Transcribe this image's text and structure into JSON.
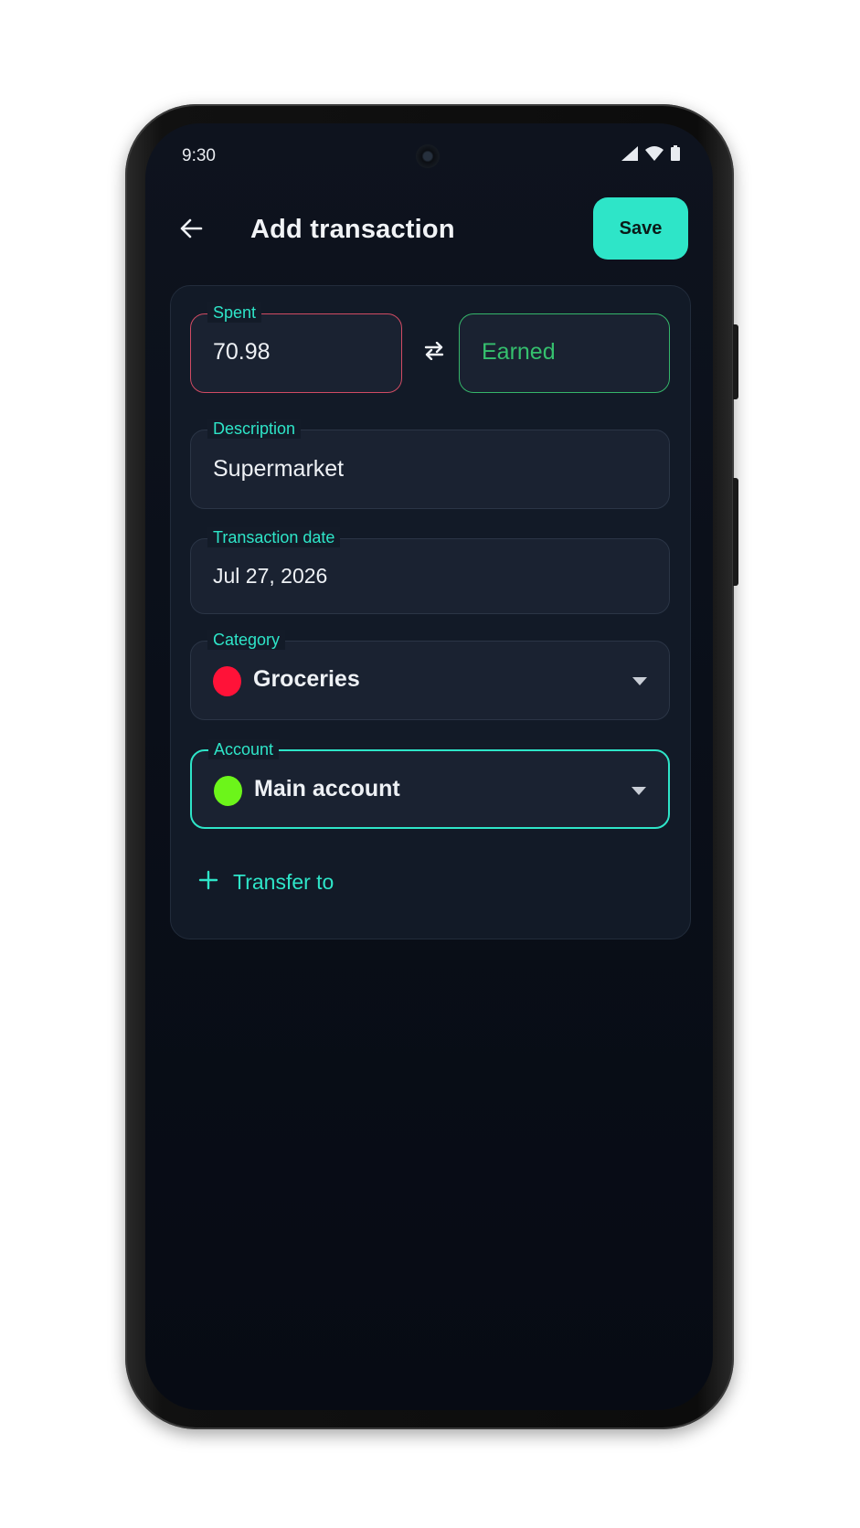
{
  "status_bar": {
    "time": "9:30",
    "icons": [
      "signal-icon",
      "wifi-icon",
      "battery-icon"
    ]
  },
  "header": {
    "title": "Add transaction",
    "back_icon": "arrow-left-icon",
    "save_label": "Save"
  },
  "form": {
    "spent": {
      "label": "Spent",
      "value": "70.98"
    },
    "swap_icon": "swap-arrows-icon",
    "earned": {
      "placeholder": "Earned"
    },
    "description": {
      "label": "Description",
      "value": "Supermarket"
    },
    "transaction_date": {
      "label": "Transaction date",
      "value": "Jul 27, 2026"
    },
    "category": {
      "label": "Category",
      "value": "Groceries",
      "color": "#ff1238"
    },
    "account": {
      "label": "Account",
      "value": "Main account",
      "color": "#6cf51a"
    },
    "transfer": {
      "label": "Transfer to",
      "icon": "plus-icon"
    }
  },
  "colors": {
    "accent": "#2ee5c8",
    "spent_border": "#d04b63",
    "earned": "#35b56a",
    "background": "#0a0f19"
  }
}
